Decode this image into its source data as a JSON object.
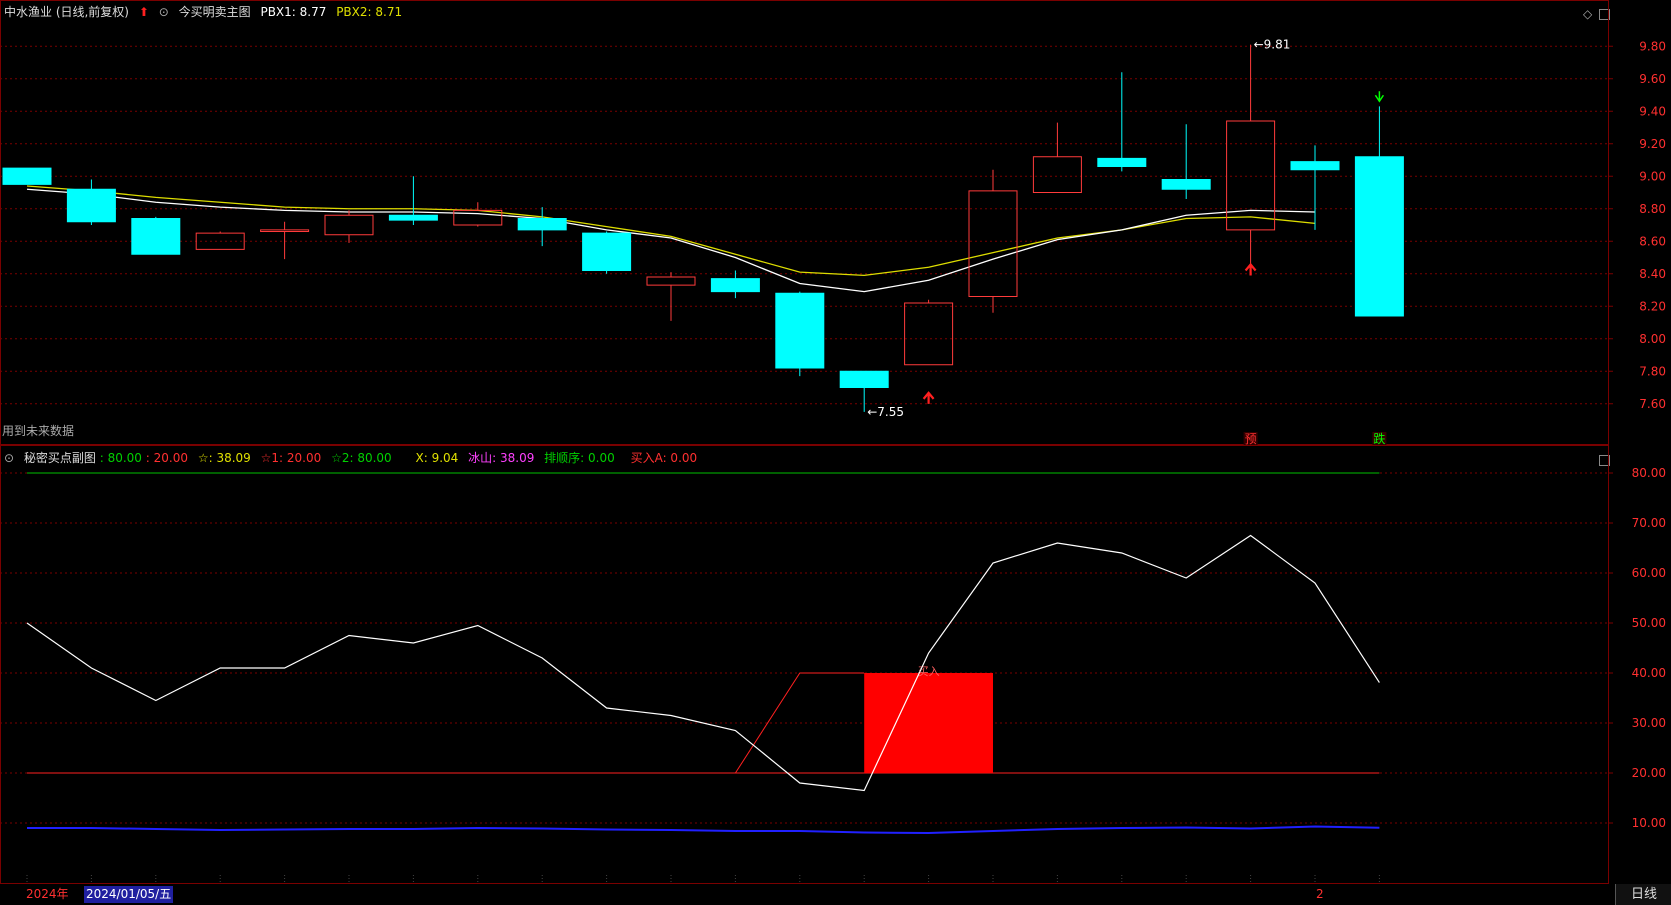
{
  "main_header": {
    "stock": "中水渔业 (日线,前复权)",
    "indicator": "今买明卖主图",
    "pbx1_label": "PBX1: 8.77",
    "pbx2_label": "PBX2: 8.71"
  },
  "future_note": "用到未来数据",
  "sub_header": {
    "name": "秘密买点副图",
    "v1": ": 80.00",
    "v2": ": 20.00",
    "star": "☆: 38.09",
    "star1": "☆1: 20.00",
    "star2": "☆2: 80.00",
    "x": "X: 9.04",
    "bingshan": "冰山: 38.09",
    "paishunxu": "排顺序: 0.00",
    "mairu": "买入A: 0.00"
  },
  "footer": {
    "year": "2024年",
    "date": "2024/01/05/五",
    "month_mark": "2",
    "period": "日线"
  },
  "colors": {
    "up": "#ff3b3b",
    "down": "#00ffff",
    "ma1": "#ffffff",
    "ma2": "#dddd00",
    "grid": "#7a0000"
  },
  "chart_data": [
    {
      "type": "candlestick",
      "ylim": [
        7.5,
        9.9
      ],
      "yticks": [
        "9.80",
        "9.60",
        "9.40",
        "9.20",
        "9.00",
        "8.80",
        "8.60",
        "8.40",
        "8.20",
        "8.00",
        "7.80",
        "7.60"
      ],
      "candles": [
        {
          "o": 9.05,
          "h": 9.05,
          "l": 8.95,
          "c": 8.95
        },
        {
          "o": 8.92,
          "h": 8.98,
          "l": 8.7,
          "c": 8.72
        },
        {
          "o": 8.74,
          "h": 8.75,
          "l": 8.52,
          "c": 8.52
        },
        {
          "o": 8.55,
          "h": 8.66,
          "l": 8.55,
          "c": 8.65
        },
        {
          "o": 8.66,
          "h": 8.72,
          "l": 8.49,
          "c": 8.67
        },
        {
          "o": 8.64,
          "h": 8.79,
          "l": 8.59,
          "c": 8.76
        },
        {
          "o": 8.76,
          "h": 9.0,
          "l": 8.7,
          "c": 8.73
        },
        {
          "o": 8.7,
          "h": 8.84,
          "l": 8.69,
          "c": 8.79
        },
        {
          "o": 8.74,
          "h": 8.81,
          "l": 8.57,
          "c": 8.67
        },
        {
          "o": 8.65,
          "h": 8.66,
          "l": 8.4,
          "c": 8.42
        },
        {
          "o": 8.33,
          "h": 8.41,
          "l": 8.11,
          "c": 8.38
        },
        {
          "o": 8.37,
          "h": 8.42,
          "l": 8.25,
          "c": 8.29
        },
        {
          "o": 8.28,
          "h": 8.29,
          "l": 7.77,
          "c": 7.82
        },
        {
          "o": 7.8,
          "h": 7.8,
          "l": 7.55,
          "c": 7.7
        },
        {
          "o": 7.84,
          "h": 8.24,
          "l": 7.84,
          "c": 8.22
        },
        {
          "o": 8.26,
          "h": 9.04,
          "l": 8.16,
          "c": 8.91
        },
        {
          "o": 8.9,
          "h": 9.33,
          "l": 8.9,
          "c": 9.12
        },
        {
          "o": 9.11,
          "h": 9.64,
          "l": 9.03,
          "c": 9.06
        },
        {
          "o": 8.98,
          "h": 9.32,
          "l": 8.86,
          "c": 8.92
        },
        {
          "o": 8.67,
          "h": 9.81,
          "l": 8.43,
          "c": 9.34
        },
        {
          "o": 9.09,
          "h": 9.19,
          "l": 8.67,
          "c": 9.04
        },
        {
          "o": 9.12,
          "h": 9.43,
          "l": 8.14,
          "c": 8.14
        }
      ],
      "ma_white": [
        8.92,
        8.89,
        8.84,
        8.81,
        8.79,
        8.78,
        8.78,
        8.77,
        8.74,
        8.67,
        8.62,
        8.5,
        8.34,
        8.29,
        8.36,
        8.49,
        8.61,
        8.67,
        8.76,
        8.79,
        8.78
      ],
      "ma_yellow": [
        8.94,
        8.91,
        8.87,
        8.84,
        8.81,
        8.8,
        8.8,
        8.79,
        8.75,
        8.69,
        8.63,
        8.52,
        8.41,
        8.39,
        8.44,
        8.53,
        8.62,
        8.67,
        8.74,
        8.75,
        8.71
      ],
      "annotations": [
        {
          "text": "9.81",
          "i": 19,
          "v": 9.81
        },
        {
          "text": "7.55",
          "i": 13,
          "v": 7.55
        }
      ],
      "signals": [
        {
          "text": "预",
          "i": 19
        },
        {
          "text": "跌",
          "i": 21
        }
      ]
    },
    {
      "type": "line",
      "ylim": [
        0,
        85
      ],
      "yticks": [
        "80.00",
        "70.00",
        "60.00",
        "50.00",
        "40.00",
        "30.00",
        "20.00",
        "10.00"
      ],
      "hlines": [
        {
          "v": 80,
          "color": "#00c000"
        },
        {
          "v": 20,
          "color": "#ff2020"
        }
      ],
      "series": [
        {
          "values": [
            50,
            41,
            34.5,
            41,
            41,
            47.5,
            46,
            49.5,
            43,
            33,
            31.5,
            28.5,
            18,
            16.5,
            44,
            62,
            66,
            64,
            59,
            67.5,
            58,
            38.09
          ],
          "color": "#ffffff"
        },
        {
          "values": [
            9.0,
            9.0,
            8.8,
            8.6,
            8.7,
            8.8,
            8.8,
            9.0,
            8.9,
            8.7,
            8.6,
            8.4,
            8.4,
            8.1,
            8.0,
            8.4,
            8.8,
            9.0,
            9.1,
            8.9,
            9.3,
            9.04
          ],
          "color": "#2020ff"
        }
      ],
      "buy_zone": {
        "start": 13,
        "end": 15,
        "low": 20,
        "high": 40,
        "label": "买入"
      },
      "ramp": {
        "points": [
          [
            11,
            20
          ],
          [
            12,
            40
          ],
          [
            13,
            40
          ]
        ]
      }
    }
  ]
}
